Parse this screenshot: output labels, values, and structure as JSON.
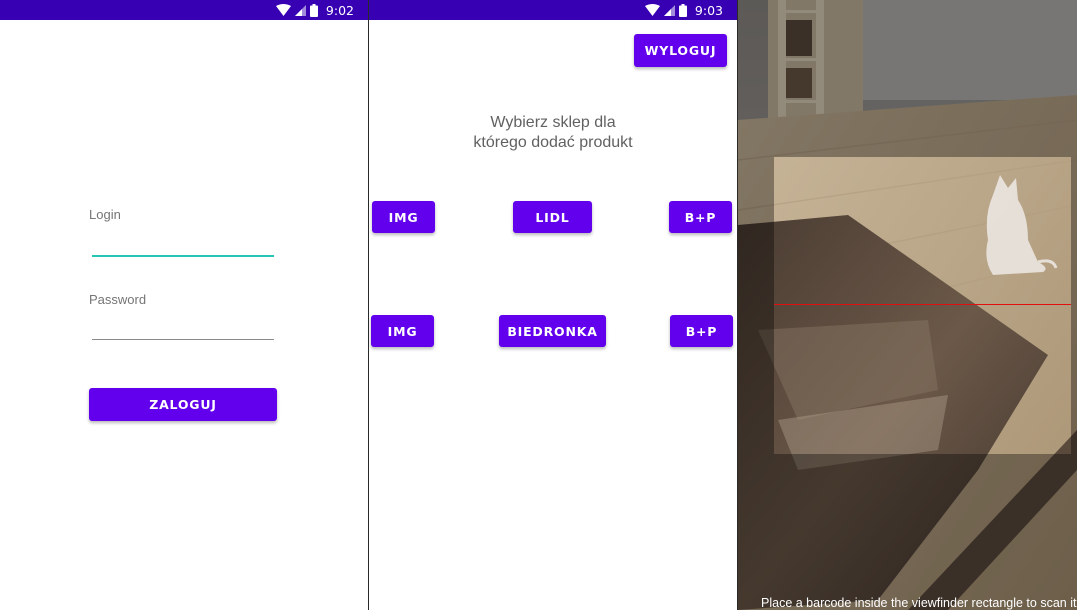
{
  "login_screen": {
    "status_bar": {
      "time": "9:02",
      "icons": [
        "wifi-icon",
        "signal-icon",
        "battery-icon"
      ]
    },
    "login_label": "Login",
    "login_value": "",
    "password_label": "Password",
    "password_value": "",
    "submit_label": "ZALOGUJ"
  },
  "shop_screen": {
    "status_bar": {
      "time": "9:03",
      "icons": [
        "wifi-icon",
        "signal-icon",
        "battery-icon"
      ]
    },
    "logout_label": "WYLOGUJ",
    "heading_line1": "Wybierz sklep dla",
    "heading_line2": "którego dodać produkt",
    "rows": [
      {
        "img_label": "IMG",
        "shop_label": "LIDL",
        "bp_label": "B+P"
      },
      {
        "img_label": "IMG",
        "shop_label": "BIEDRONKA",
        "bp_label": "B+P"
      }
    ]
  },
  "scanner_screen": {
    "hint": "Place a barcode inside the viewfinder rectangle to scan it",
    "laser_color": "#e01010"
  },
  "colors": {
    "primary": "#6200ee",
    "status_bar": "#3700b3",
    "focused_underline": "#26c6b5",
    "underline": "#8a8a8a"
  }
}
